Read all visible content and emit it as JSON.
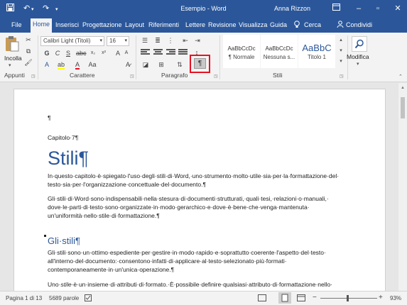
{
  "titlebar": {
    "title": "Esempio - Word",
    "user": "Anna Rizzon"
  },
  "tabs": [
    {
      "label": "File"
    },
    {
      "label": "Home"
    },
    {
      "label": "Inserisci"
    },
    {
      "label": "Progettazione"
    },
    {
      "label": "Layout"
    },
    {
      "label": "Riferimenti"
    },
    {
      "label": "Lettere"
    },
    {
      "label": "Revisione"
    },
    {
      "label": "Visualizza"
    },
    {
      "label": "Guida"
    }
  ],
  "tell_me": "Cerca",
  "share": "Condividi",
  "ribbon": {
    "paste_label": "Incolla",
    "font_name": "Calibri Light (Titoli)",
    "font_size": "16",
    "groups": {
      "clipboard": "Appunti",
      "font": "Carattere",
      "paragraph": "Paragrafo",
      "styles": "Stili",
      "editing": "Modifica"
    },
    "styles": [
      {
        "preview": "AaBbCcDc",
        "name": "¶ Normale"
      },
      {
        "preview": "AaBbCcDc",
        "name": "Nessuna s..."
      },
      {
        "preview": "AaBbC",
        "name": "Titolo 1"
      }
    ],
    "edit_label": "Modifica",
    "pilcrow": "¶"
  },
  "document": {
    "empty_para": "¶",
    "chapter": "Capitolo·7¶",
    "title": "Stili¶",
    "p1": [
      "In·questo·capitolo·è·spiegato·l'uso·degli·stili·di·Word,·uno·strumento·molto·utile·sia·per·la·formattazione·del·",
      "testo·sia·per·l'organizzazione·concettuale·del·documento.¶"
    ],
    "p2": [
      "Gli·stili·di·Word·sono·indispensabili·nella·stesura·di·documenti·strutturati,·quali·tesi,·relazioni·o·manuali,·",
      "dove·le·parti·di·testo·sono·organizzate·in·modo·gerarchico·e·dove·è·bene·che·venga·mantenuta·",
      "un'uniformità·nello·stile·di·formattazione.¶"
    ],
    "heading2": "Gli·stili¶",
    "p3": [
      "Gli·stili·sono·un·ottimo·espediente·per·gestire·in·modo·rapido·e·soprattutto·coerente·l'aspetto·del·testo·",
      "all'interno·del·documento:·consentono·infatti·di·applicare·al·testo·selezionato·più·formati·",
      "contemporaneamente·in·un'unica·operazione.¶"
    ],
    "p4_pre": "Uno·",
    "p4_em": "stile",
    "p4_post": "·è·un·insieme·di·attributi·di·formato.·È·possibile·definire·qualsiasi·attributo·di·formattazione·nello·"
  },
  "statusbar": {
    "page": "Pagina 1 di 13",
    "words": "5689 parole",
    "zoom": "93%"
  },
  "highlight_color": "#e81123",
  "accent": "#2b579a"
}
